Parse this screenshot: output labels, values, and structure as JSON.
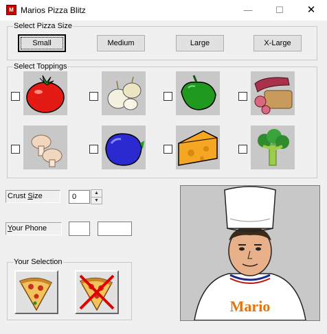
{
  "window": {
    "title": "Marios Pizza Blitz",
    "icon": "app-icon",
    "minimize": "—",
    "maximize": "☐",
    "close": "✕"
  },
  "size_group": {
    "label": "Select Pizza Size",
    "buttons": [
      {
        "label": "Small",
        "focused": true
      },
      {
        "label": "Medium"
      },
      {
        "label": "Large"
      },
      {
        "label": "X-Large"
      }
    ]
  },
  "toppings_group": {
    "label": "Select Toppings",
    "items": [
      {
        "icon": "tomato-icon",
        "checked": false
      },
      {
        "icon": "onion-icon",
        "checked": false
      },
      {
        "icon": "green-pepper-icon",
        "checked": false
      },
      {
        "icon": "salami-icon",
        "checked": false
      },
      {
        "icon": "mushroom-icon",
        "checked": false
      },
      {
        "icon": "blue-pepper-icon",
        "checked": false
      },
      {
        "icon": "cheese-icon",
        "checked": false
      },
      {
        "icon": "broccoli-icon",
        "checked": false
      }
    ]
  },
  "crust": {
    "label_pre": "Crust ",
    "label_accel": "S",
    "label_post": "ize",
    "value": "0"
  },
  "phone": {
    "label_accel": "Y",
    "label_post": "our Phone",
    "area_code": "",
    "number": ""
  },
  "selection_group": {
    "label": "Your Selection",
    "buttons": [
      "pizza-slice-icon",
      "cancel-pizza-icon"
    ]
  },
  "chef": {
    "name": "Mario"
  },
  "colors": {
    "accent": "#e8730c",
    "tile_bg": "#c8c8c8"
  }
}
